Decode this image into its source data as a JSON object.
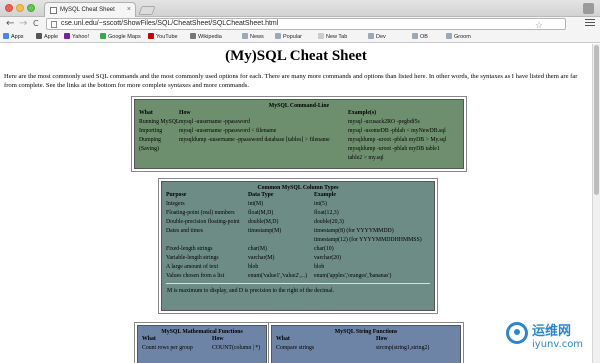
{
  "browser": {
    "tab_title": "MySQL Cheat Sheet",
    "tab_close": "×",
    "back": "←",
    "forward": "→",
    "reload": "C",
    "url": "cse.unl.edu/~sscott/ShowFiles/SQL/CheatSheet/SQLCheatSheet.html",
    "star": "☆",
    "bookmarks": [
      "Apps",
      "Apple",
      "Yahoo!",
      "Google Maps",
      "YouTube",
      "Wikipedia",
      "News",
      "Popular",
      "New Tab",
      "Dev",
      "OB",
      "Groom"
    ],
    "bookmark_colors": [
      "#4a86e8",
      "#555555",
      "#7b1fa2",
      "#34a853",
      "#cc0000",
      "#777777",
      "#9aa8b7",
      "#9aa8b7",
      "#cccccc",
      "#9aa8b7",
      "#9aa8b7",
      "#9aa8b7"
    ]
  },
  "page": {
    "title": "(My)SQL Cheat Sheet",
    "intro": "Here are the most commonly used SQL commands and the most commonly used options for each. There are many more commands and options than listed here. In other words, the syntaxes as I have listed them are far from complete. See the links at the bottom for more complete syntaxes and more commands."
  },
  "cmdline": {
    "title": "MySQL Command-Line",
    "headers": [
      "What",
      "How",
      "Example(s)"
    ],
    "rows": [
      [
        "Running MySQL",
        "mysql -uusername -ppassword",
        "mysql -ucusack2RO -pegbdf5s"
      ],
      [
        "Importing",
        "mysql -uusername -ppassword < filename",
        "mysql -usomeDB -pblah < myNewDB.sql"
      ],
      [
        "Dumping",
        "mysqldump -uusername -ppassword database [tables] > filename",
        "mysqldump -uroot -pblah myDB > My.sql"
      ],
      [
        "(Saving)",
        "",
        "mysqldump -uroot -pblah myDB table1"
      ],
      [
        "",
        "",
        "table2 > my.sql"
      ]
    ]
  },
  "coltypes": {
    "title": "Common MySQL Column Types",
    "headers": [
      "Purpose",
      "Data Type",
      "Example"
    ],
    "rows": [
      [
        "Integers",
        "int(M)",
        "int(5)"
      ],
      [
        "Floating-point (real) numbers",
        "float(M,D)",
        "float(12,3)"
      ],
      [
        "Double-precision floating-point",
        "double(M,D)",
        "double(20,3)"
      ],
      [
        "Dates and times",
        "timestamp(M)",
        "timestamp(8) (for YYYYMMDD)"
      ],
      [
        "",
        "",
        "timestamp(12) (for YYYYMMDDHHMMSS)"
      ],
      [
        "Fixed-length strings",
        "char(M)",
        "char(10)"
      ],
      [
        "Variable-length strings",
        "varchar(M)",
        "varchar(20)"
      ],
      [
        "A large amount of text",
        "blob",
        "blob"
      ],
      [
        "Values chosen from a list",
        "enum('value1','value2',...)",
        "enum('apples','oranges','bananas')"
      ]
    ],
    "note": "M is maximum to display, and D is precision to the right of the decimal."
  },
  "mathfuncs": {
    "title": "MySQL Mathematical Functions",
    "headers": [
      "What",
      "How"
    ],
    "rows": [
      [
        "Count rows per group",
        "COUNT(column | *)"
      ]
    ]
  },
  "strfuncs": {
    "title": "MySQL String Functions",
    "headers": [
      "What",
      "How"
    ],
    "rows": [
      [
        "Compare strings",
        "strcmp(string1,string2)"
      ]
    ]
  },
  "watermark": {
    "cn": "运维网",
    "en": "iyunv.com"
  }
}
